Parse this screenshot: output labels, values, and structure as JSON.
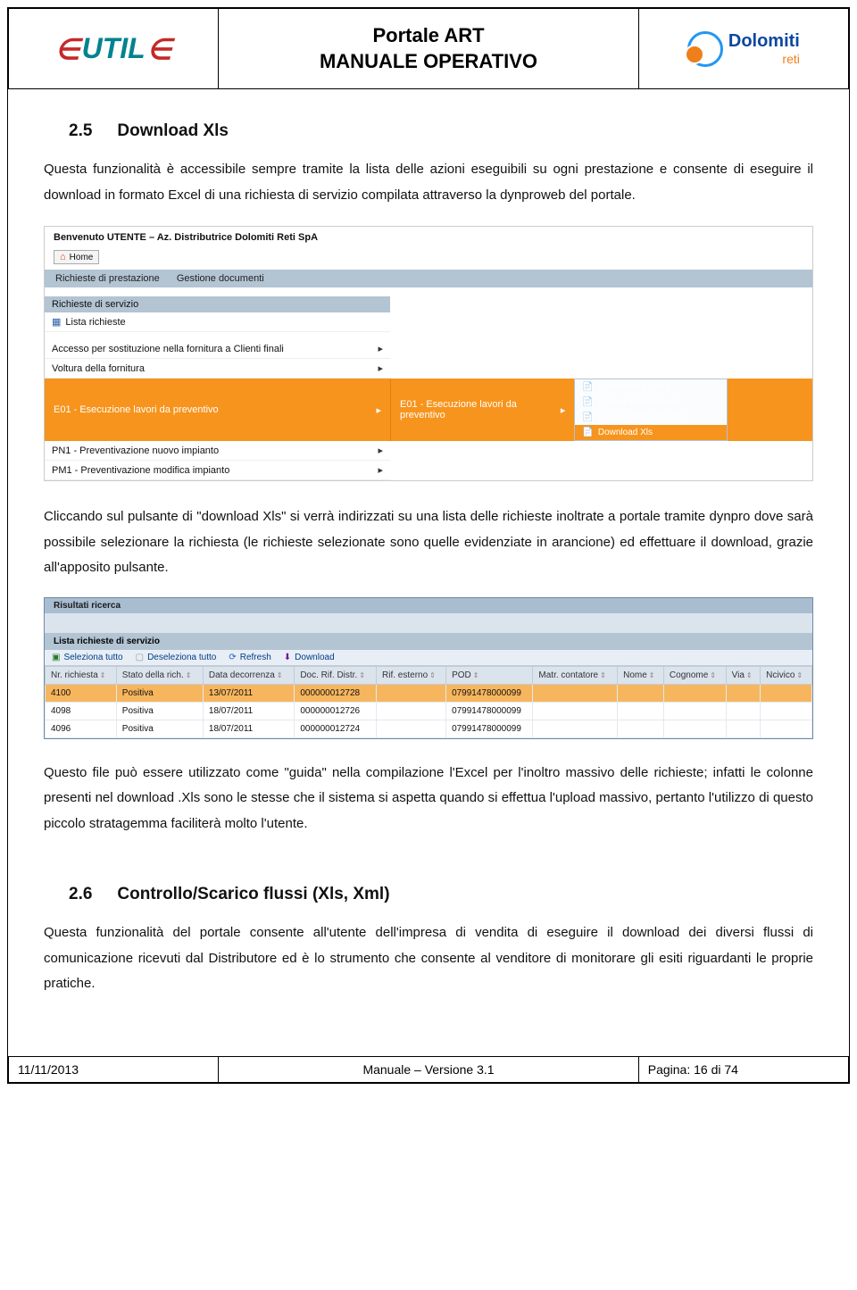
{
  "header": {
    "title_line1": "Portale ART",
    "title_line2": "MANUALE OPERATIVO",
    "logo_eutile_1": "∈",
    "logo_eutile_2": "UTIL",
    "logo_eutile_3": "∈",
    "logo_dolomiti_main": "Dolomiti",
    "logo_dolomiti_sub": "reti"
  },
  "section25": {
    "num": "2.5",
    "title": "Download Xls",
    "para1": "Questa funzionalità è accessibile sempre tramite la lista delle azioni eseguibili su ogni prestazione e consente di eseguire il download in formato Excel di una richiesta di servizio compilata attraverso la dynproweb del portale.",
    "para2": "Cliccando sul pulsante di \"download Xls\" si verrà indirizzati su una lista delle richieste inoltrate a portale tramite dynpro dove sarà possibile selezionare la richiesta (le richieste selezionate sono quelle evidenziate in arancione) ed effettuare il download, grazie all'apposito pulsante.",
    "para3": "Questo file può essere utilizzato come \"guida\" nella compilazione l'Excel per l'inoltro massivo delle richieste; infatti le colonne presenti nel download .Xls sono le stesse che il sistema si aspetta quando si effettua l'upload massivo, pertanto l'utilizzo di questo piccolo stratagemma faciliterà molto l'utente."
  },
  "screenshot1": {
    "welcome": "Benvenuto UTENTE – Az. Distributrice Dolomiti Reti SpA",
    "home": "Home",
    "menubar": {
      "m1": "Richieste di prestazione",
      "m2": "Gestione documenti"
    },
    "sidebar_title": "Richieste di servizio",
    "rows": {
      "r0": "Lista richieste",
      "r1": "Accesso per sostituzione nella fornitura a Clienti finali",
      "r2": "Voltura della fornitura",
      "r3_code": "E01 - Esecuzione lavori da preventivo",
      "r4": "PN1 - Preventivazione nuovo impianto",
      "r5": "PM1 - Preventivazione modifica impianto"
    },
    "orange_mid": "E01 - Esecuzione lavori da preventivo",
    "submenu": {
      "s1": "Creazione singola",
      "s2": "Upload Xls Richieste",
      "s3": "Upload Xml Richieste",
      "s4": "Download Xls"
    }
  },
  "screenshot2": {
    "top": "Risultati ricerca",
    "sub": "Lista richieste di servizio",
    "toolbar": {
      "b1": "Seleziona tutto",
      "b2": "Deseleziona tutto",
      "b3": "Refresh",
      "b4": "Download"
    },
    "columns": {
      "c1": "Nr. richiesta",
      "c2": "Stato della rich.",
      "c3": "Data decorrenza",
      "c4": "Doc. Rif. Distr.",
      "c5": "Rif. esterno",
      "c6": "POD",
      "c7": "Matr. contatore",
      "c8": "Nome",
      "c9": "Cognome",
      "c10": "Via",
      "c11": "Ncivico"
    },
    "rows": [
      {
        "nr": "4100",
        "stato": "Positiva",
        "data": "13/07/2011",
        "doc": "000000012728",
        "rif": "",
        "pod": "07991478000099",
        "matr": "",
        "nome": "",
        "cogn": "",
        "via": "",
        "nc": ""
      },
      {
        "nr": "4098",
        "stato": "Positiva",
        "data": "18/07/2011",
        "doc": "000000012726",
        "rif": "",
        "pod": "07991478000099",
        "matr": "",
        "nome": "",
        "cogn": "",
        "via": "",
        "nc": ""
      },
      {
        "nr": "4096",
        "stato": "Positiva",
        "data": "18/07/2011",
        "doc": "000000012724",
        "rif": "",
        "pod": "07991478000099",
        "matr": "",
        "nome": "",
        "cogn": "",
        "via": "",
        "nc": ""
      }
    ]
  },
  "section26": {
    "num": "2.6",
    "title": "Controllo/Scarico flussi (Xls, Xml)",
    "para1": "Questa funzionalità del portale consente all'utente dell'impresa di vendita di eseguire il download dei diversi flussi di comunicazione ricevuti dal Distributore ed è lo strumento che consente al venditore di monitorare gli esiti riguardanti le proprie pratiche."
  },
  "footer": {
    "date": "11/11/2013",
    "center": "Manuale – Versione 3.1",
    "page": "Pagina: 16 di 74"
  }
}
